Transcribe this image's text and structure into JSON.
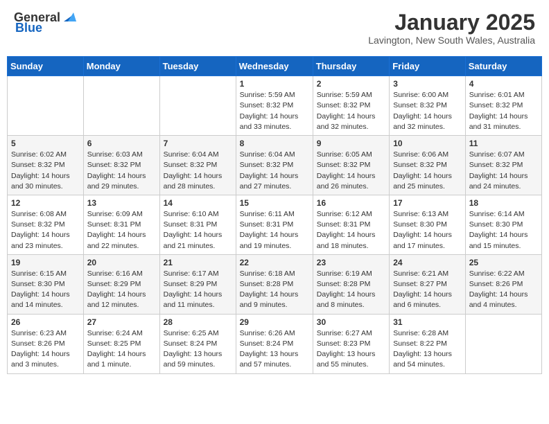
{
  "header": {
    "logo_general": "General",
    "logo_blue": "Blue",
    "month": "January 2025",
    "location": "Lavington, New South Wales, Australia"
  },
  "days_of_week": [
    "Sunday",
    "Monday",
    "Tuesday",
    "Wednesday",
    "Thursday",
    "Friday",
    "Saturday"
  ],
  "weeks": [
    [
      {
        "day": "",
        "content": ""
      },
      {
        "day": "",
        "content": ""
      },
      {
        "day": "",
        "content": ""
      },
      {
        "day": "1",
        "content": "Sunrise: 5:59 AM\nSunset: 8:32 PM\nDaylight: 14 hours\nand 33 minutes."
      },
      {
        "day": "2",
        "content": "Sunrise: 5:59 AM\nSunset: 8:32 PM\nDaylight: 14 hours\nand 32 minutes."
      },
      {
        "day": "3",
        "content": "Sunrise: 6:00 AM\nSunset: 8:32 PM\nDaylight: 14 hours\nand 32 minutes."
      },
      {
        "day": "4",
        "content": "Sunrise: 6:01 AM\nSunset: 8:32 PM\nDaylight: 14 hours\nand 31 minutes."
      }
    ],
    [
      {
        "day": "5",
        "content": "Sunrise: 6:02 AM\nSunset: 8:32 PM\nDaylight: 14 hours\nand 30 minutes."
      },
      {
        "day": "6",
        "content": "Sunrise: 6:03 AM\nSunset: 8:32 PM\nDaylight: 14 hours\nand 29 minutes."
      },
      {
        "day": "7",
        "content": "Sunrise: 6:04 AM\nSunset: 8:32 PM\nDaylight: 14 hours\nand 28 minutes."
      },
      {
        "day": "8",
        "content": "Sunrise: 6:04 AM\nSunset: 8:32 PM\nDaylight: 14 hours\nand 27 minutes."
      },
      {
        "day": "9",
        "content": "Sunrise: 6:05 AM\nSunset: 8:32 PM\nDaylight: 14 hours\nand 26 minutes."
      },
      {
        "day": "10",
        "content": "Sunrise: 6:06 AM\nSunset: 8:32 PM\nDaylight: 14 hours\nand 25 minutes."
      },
      {
        "day": "11",
        "content": "Sunrise: 6:07 AM\nSunset: 8:32 PM\nDaylight: 14 hours\nand 24 minutes."
      }
    ],
    [
      {
        "day": "12",
        "content": "Sunrise: 6:08 AM\nSunset: 8:32 PM\nDaylight: 14 hours\nand 23 minutes."
      },
      {
        "day": "13",
        "content": "Sunrise: 6:09 AM\nSunset: 8:31 PM\nDaylight: 14 hours\nand 22 minutes."
      },
      {
        "day": "14",
        "content": "Sunrise: 6:10 AM\nSunset: 8:31 PM\nDaylight: 14 hours\nand 21 minutes."
      },
      {
        "day": "15",
        "content": "Sunrise: 6:11 AM\nSunset: 8:31 PM\nDaylight: 14 hours\nand 19 minutes."
      },
      {
        "day": "16",
        "content": "Sunrise: 6:12 AM\nSunset: 8:31 PM\nDaylight: 14 hours\nand 18 minutes."
      },
      {
        "day": "17",
        "content": "Sunrise: 6:13 AM\nSunset: 8:30 PM\nDaylight: 14 hours\nand 17 minutes."
      },
      {
        "day": "18",
        "content": "Sunrise: 6:14 AM\nSunset: 8:30 PM\nDaylight: 14 hours\nand 15 minutes."
      }
    ],
    [
      {
        "day": "19",
        "content": "Sunrise: 6:15 AM\nSunset: 8:30 PM\nDaylight: 14 hours\nand 14 minutes."
      },
      {
        "day": "20",
        "content": "Sunrise: 6:16 AM\nSunset: 8:29 PM\nDaylight: 14 hours\nand 12 minutes."
      },
      {
        "day": "21",
        "content": "Sunrise: 6:17 AM\nSunset: 8:29 PM\nDaylight: 14 hours\nand 11 minutes."
      },
      {
        "day": "22",
        "content": "Sunrise: 6:18 AM\nSunset: 8:28 PM\nDaylight: 14 hours\nand 9 minutes."
      },
      {
        "day": "23",
        "content": "Sunrise: 6:19 AM\nSunset: 8:28 PM\nDaylight: 14 hours\nand 8 minutes."
      },
      {
        "day": "24",
        "content": "Sunrise: 6:21 AM\nSunset: 8:27 PM\nDaylight: 14 hours\nand 6 minutes."
      },
      {
        "day": "25",
        "content": "Sunrise: 6:22 AM\nSunset: 8:26 PM\nDaylight: 14 hours\nand 4 minutes."
      }
    ],
    [
      {
        "day": "26",
        "content": "Sunrise: 6:23 AM\nSunset: 8:26 PM\nDaylight: 14 hours\nand 3 minutes."
      },
      {
        "day": "27",
        "content": "Sunrise: 6:24 AM\nSunset: 8:25 PM\nDaylight: 14 hours\nand 1 minute."
      },
      {
        "day": "28",
        "content": "Sunrise: 6:25 AM\nSunset: 8:24 PM\nDaylight: 13 hours\nand 59 minutes."
      },
      {
        "day": "29",
        "content": "Sunrise: 6:26 AM\nSunset: 8:24 PM\nDaylight: 13 hours\nand 57 minutes."
      },
      {
        "day": "30",
        "content": "Sunrise: 6:27 AM\nSunset: 8:23 PM\nDaylight: 13 hours\nand 55 minutes."
      },
      {
        "day": "31",
        "content": "Sunrise: 6:28 AM\nSunset: 8:22 PM\nDaylight: 13 hours\nand 54 minutes."
      },
      {
        "day": "",
        "content": ""
      }
    ]
  ]
}
